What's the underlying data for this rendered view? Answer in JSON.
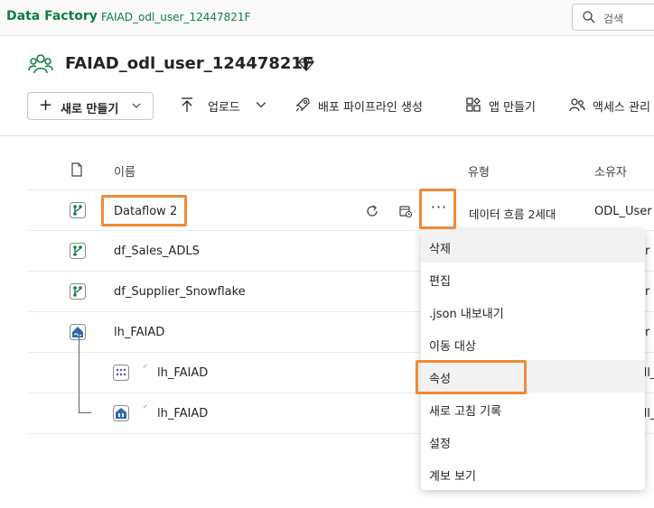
{
  "topbar": {
    "app_name": "Data Factory",
    "workspace_crumb": "FAIAD_odl_user_12447821F",
    "search_placeholder": "검색"
  },
  "workspace": {
    "title": "FAIAD_odl_user_12447821F"
  },
  "toolbar": {
    "new_label": "새로 만들기",
    "upload_label": "업로드",
    "pipeline_label": "배포 파이프라인 생성",
    "app_label": "앱 만들기",
    "access_label": "액세스 관리"
  },
  "table": {
    "headers": {
      "name": "이름",
      "type": "유형",
      "owner": "소유자"
    },
    "rows": [
      {
        "name": "Dataflow 2",
        "type": "데이터 흐름 2세대",
        "owner": "ODL_User"
      },
      {
        "name": "df_Sales_ADLS",
        "owner_partial": "r"
      },
      {
        "name": "df_Supplier_Snowflake",
        "owner_partial": "r"
      },
      {
        "name": "lh_FAIAD",
        "owner_partial": "r"
      },
      {
        "name": "lh_FAIAD",
        "owner_partial": "dl_"
      },
      {
        "name": "lh_FAIAD",
        "owner_partial": "dl_"
      }
    ]
  },
  "context_menu": {
    "items": [
      "삭제",
      "편집",
      ".json 내보내기",
      "이동 대상",
      "속성",
      "새로 고침 기록",
      "설정",
      "계보 보기"
    ]
  },
  "colors": {
    "brand_green": "#107c41",
    "highlight_orange": "#f08a35"
  }
}
